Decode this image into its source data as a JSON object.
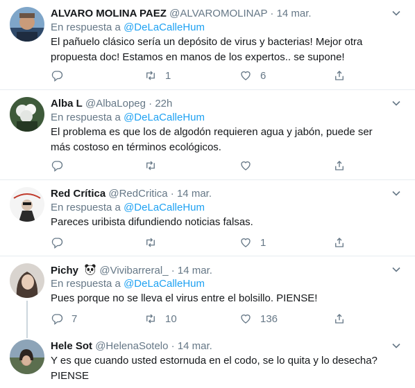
{
  "tweets": [
    {
      "name": "ALVARO MOLINA PAEZ",
      "handle": "@ALVAROMOLINAP",
      "separator": "·",
      "time": "14 mar.",
      "reply_prefix": "En respuesta a",
      "reply_to": "@DeLaCalleHum",
      "text": "El pañuelo clásico sería un depósito de virus y bacterias! Mejor otra propuesta doc! Estamos en manos de los expertos.. se supone!",
      "replies": "",
      "retweets": "1",
      "likes": "6"
    },
    {
      "name": "Alba L",
      "handle": "@AlbaLopeg",
      "separator": "·",
      "time": "22h",
      "reply_prefix": "En respuesta a",
      "reply_to": "@DeLaCalleHum",
      "text": "El problema es que los de algodón requieren agua y jabón, puede ser más costoso en términos ecológicos.",
      "replies": "",
      "retweets": "",
      "likes": ""
    },
    {
      "name": "Red Crítica",
      "handle": "@RedCritica",
      "separator": "·",
      "time": "14 mar.",
      "reply_prefix": "En respuesta a",
      "reply_to": "@DeLaCalleHum",
      "text": "Pareces uribista difundiendo noticias falsas.",
      "replies": "",
      "retweets": "",
      "likes": "1"
    },
    {
      "name": "Pichy",
      "handle": "@Vivibarreral_",
      "separator": "·",
      "time": "14 mar.",
      "reply_prefix": "En respuesta a",
      "reply_to": "@DeLaCalleHum",
      "text": "Pues porque no se lleva el virus entre el bolsillo. PIENSE!",
      "replies": "7",
      "retweets": "10",
      "likes": "136"
    },
    {
      "name": "Hele Sot",
      "handle": "@HelenaSotelo",
      "separator": "·",
      "time": "14 mar.",
      "text": "Y es que cuando usted estornuda en el codo, se lo quita y lo desecha? PIENSE"
    }
  ],
  "icons": {
    "reply": "reply-icon",
    "retweet": "retweet-icon",
    "like": "heart-icon",
    "share": "share-icon",
    "more": "chevron-down-icon",
    "name_emoji": "panda-icon"
  },
  "colors": {
    "accent": "#1da1f2",
    "muted": "#657786",
    "text": "#14171a",
    "divider": "#e6ecf0"
  }
}
